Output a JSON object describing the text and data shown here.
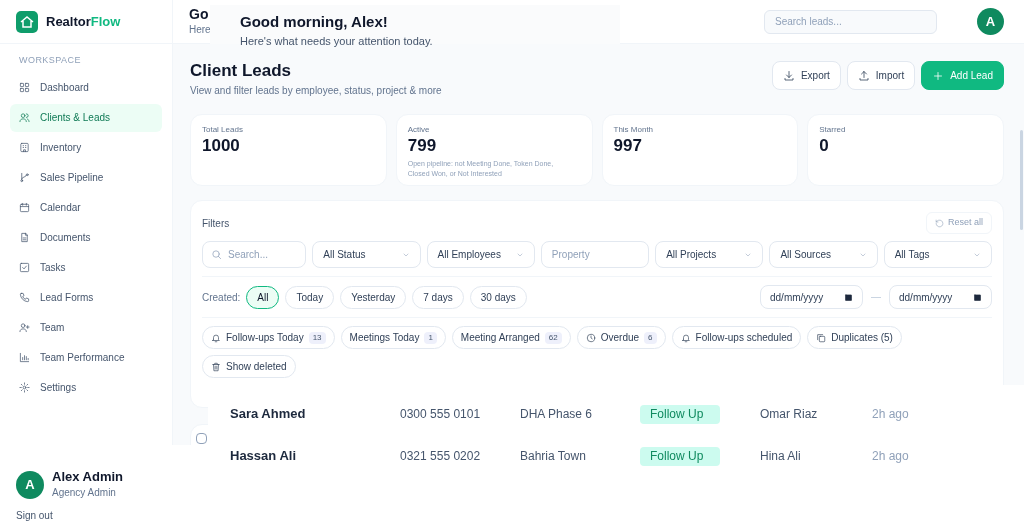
{
  "brand": {
    "name_part1": "Realtor",
    "name_part2": "Flow"
  },
  "sidebar": {
    "section": "WORKSPACE",
    "items": [
      {
        "label": "Dashboard",
        "selected": false
      },
      {
        "label": "Clients & Leads",
        "selected": true
      },
      {
        "label": "Inventory",
        "selected": false
      },
      {
        "label": "Sales Pipeline",
        "selected": false
      },
      {
        "label": "Calendar",
        "selected": false
      },
      {
        "label": "Documents",
        "selected": false
      },
      {
        "label": "Tasks",
        "selected": false
      },
      {
        "label": "Lead Forms",
        "selected": false
      },
      {
        "label": "Team",
        "selected": false
      },
      {
        "label": "Team Performance",
        "selected": false
      },
      {
        "label": "Settings",
        "selected": false
      }
    ],
    "user": {
      "avatar": "A",
      "name": "Alex Admin",
      "role": "Agency Admin",
      "sign_out": "Sign out"
    }
  },
  "header": {
    "title": "Go",
    "subtitle": "Here",
    "search_placeholder": "Search leads...",
    "avatar": "A"
  },
  "greeting": {
    "title": "Good morning, Alex!",
    "subtitle": "Here's what needs your attention today."
  },
  "page": {
    "title": "Client Leads",
    "subtitle": "View and filter leads by employee, status, project & more",
    "actions": [
      {
        "label": "Export",
        "kind": "outline"
      },
      {
        "label": "Import",
        "kind": "outline"
      },
      {
        "label": "Add Lead",
        "kind": "primary"
      }
    ]
  },
  "stats": [
    {
      "label": "Total Leads",
      "value": "1000"
    },
    {
      "label": "Active",
      "value": "799",
      "note": "Open pipeline: not Meeting Done, Token Done, Closed Won, or Not Interested"
    },
    {
      "label": "This Month",
      "value": "997"
    },
    {
      "label": "Starred",
      "value": "0"
    }
  ],
  "filters": {
    "title": "Filters",
    "reset": "Reset all",
    "reset_disabled": true,
    "search_placeholder": "Search...",
    "fields": [
      {
        "kind": "select",
        "text": "All Status"
      },
      {
        "kind": "select",
        "text": "All Employees"
      },
      {
        "kind": "input",
        "placeholder": "Property"
      },
      {
        "kind": "select",
        "text": "All Projects"
      },
      {
        "kind": "select",
        "text": "All Sources"
      },
      {
        "kind": "select",
        "text": "All Tags"
      }
    ],
    "created_label": "Created:",
    "created": [
      {
        "label": "All",
        "selected": true
      },
      {
        "label": "Today",
        "selected": false
      },
      {
        "label": "Yesterday",
        "selected": false
      },
      {
        "label": "7 days",
        "selected": false
      },
      {
        "label": "30 days",
        "selected": false
      }
    ],
    "date_from": "dd/mm/yyyy",
    "date_to": "dd/mm/yyyy",
    "quick": [
      {
        "label": "Follow-ups Today",
        "count": "13"
      },
      {
        "label": "Meetings Today",
        "count": "1"
      },
      {
        "label": "Meeting Arranged",
        "count": "62"
      },
      {
        "label": "Overdue",
        "count": "6"
      },
      {
        "label": "Follow-ups scheduled"
      },
      {
        "label": "Duplicates (5)"
      },
      {
        "label": "Show deleted"
      }
    ]
  },
  "table": {
    "select_all_checked": false
  },
  "leads": [
    {
      "name": "Sara Ahmed",
      "phone": "0300 555 0101",
      "project": "DHA Phase 6",
      "status": "Follow Up",
      "agent": "Omar Riaz",
      "time": "2h ago"
    },
    {
      "name": "Hassan Ali",
      "phone": "0321 555 0202",
      "project": "Bahria Town",
      "status": "Follow Up",
      "agent": "Hina Ali",
      "time": "2h ago"
    }
  ]
}
